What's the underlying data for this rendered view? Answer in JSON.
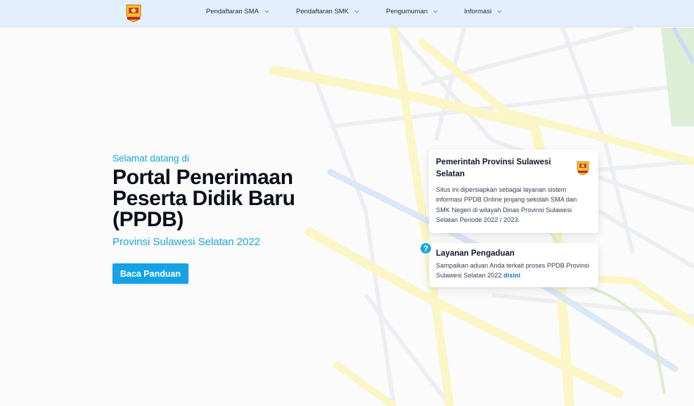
{
  "navbar": {
    "items": [
      {
        "label": "Pendaftaran SMA"
      },
      {
        "label": "Pendaftaran SMK"
      },
      {
        "label": "Pengumuman"
      },
      {
        "label": "Informasi"
      }
    ]
  },
  "hero": {
    "welcome": "Selamat datang di",
    "title": "Portal Penerimaan Peserta Didik Baru (PPDB)",
    "subtitle": "Provinsi Sulawesi Selatan 2022",
    "button_label": "Baca Panduan"
  },
  "cards": {
    "government": {
      "title": "Pemerintah Provinsi Sulawesi Selatan",
      "body": "Situs ini dipersiapkan sebagai layanan sistem informasi PPDB Online jenjang sekolah SMA dan SMK Negeri di wilayah Dinas Provinsi Sulawesi Selatan Periode 2022 / 2023."
    },
    "complaint": {
      "title": "Layanan Pengaduan",
      "body": "Sampaikan aduan Anda terkait proses PPDB Provinsi Sulawesi Selatan 2022",
      "link_label": "disini",
      "icon_glyph": "?"
    }
  },
  "colors": {
    "accent": "#1aa3e0",
    "button": "#15a3e6",
    "navbar": "#e3effc",
    "link": "#1a73c9"
  },
  "icons": [
    "logo-emblem",
    "chevron-down-icon",
    "seal-icon",
    "help-icon"
  ]
}
